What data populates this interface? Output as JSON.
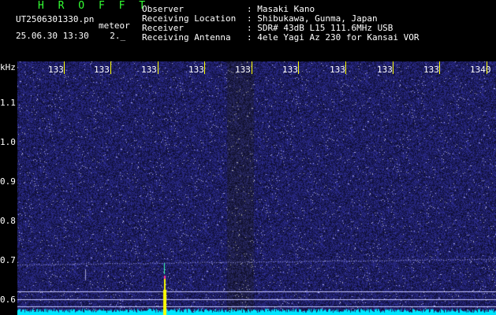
{
  "header": {
    "app_title": "H R O F F T",
    "filename": "UT2506301330.pn",
    "filename_suffix": "meteor",
    "datetime": "25.06.30 13:30",
    "counter": "2._",
    "fields": [
      {
        "label": "Observer",
        "value": ": Masaki Kano"
      },
      {
        "label": "Receiving Location",
        "value": ": Shibukawa, Gunma, Japan"
      },
      {
        "label": "Receiver",
        "value": ": SDR# 43dB L15 111.6MHz USB"
      },
      {
        "label": "Receiving Antenna",
        "value": ": 4ele Yagi Az 230 for Kansai VOR"
      }
    ]
  },
  "waterfall": {
    "y_unit": "kHz",
    "y_ticks": [
      "1.1",
      "1.0",
      "0.9",
      "0.8",
      "0.7",
      "0.6"
    ],
    "x_ticks": [
      "133",
      "133",
      "133",
      "133",
      "133",
      "133",
      "133",
      "133",
      "133",
      "1340"
    ],
    "colors": {
      "background": "#0a0a3c",
      "noise": "#2828c8",
      "baseline": "#00e6ff",
      "meteor": "#ffff00",
      "reference_line": "#c8c8ff",
      "tick": "#ffff00"
    }
  }
}
